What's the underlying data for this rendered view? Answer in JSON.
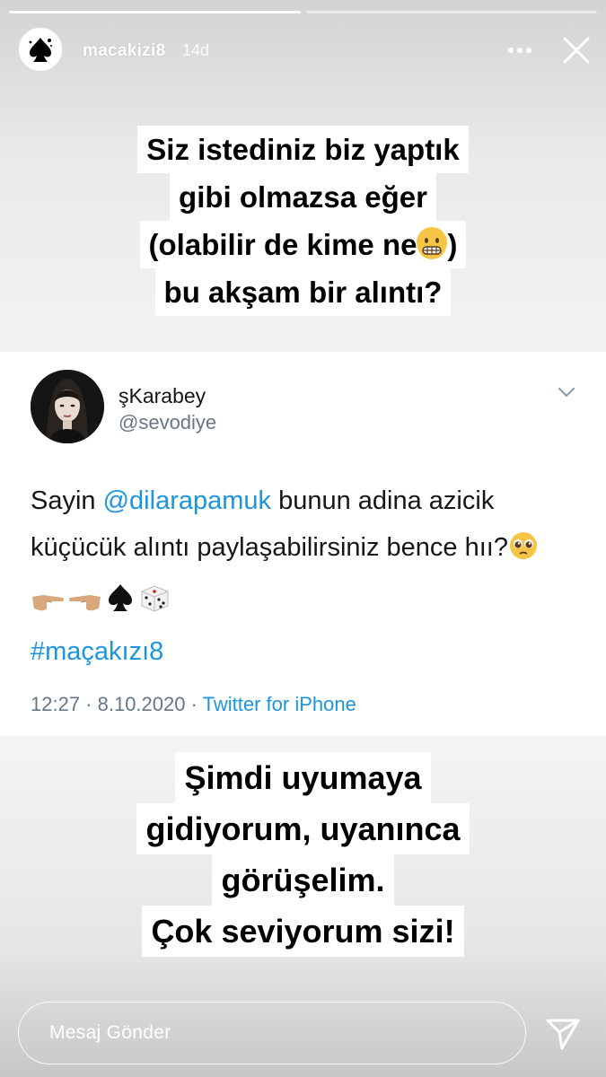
{
  "story": {
    "progress": [
      1.0,
      0.0
    ],
    "username": "macakizi8",
    "time_ago": "14d",
    "top_caption": [
      "Siz istediniz biz yaptık",
      "gibi olmazsa eğer",
      "(olabilir de kime ne",
      ")",
      "bu akşam bir alıntı?"
    ],
    "bottom_caption": [
      "Şimdi uyumaya",
      "gidiyorum, uyanınca",
      "görüşelim.",
      "Çok seviyorum sizi!"
    ],
    "message_placeholder": "Mesaj Gönder"
  },
  "tweet": {
    "name": "şKarabey",
    "handle": "@sevodiye",
    "body_pre": "Sayin ",
    "mention": "@dilarapamuk",
    "body_post": " bunun adina azicik küçücük alıntı paylaşabilirsiniz bence hıı?",
    "hashtag": "#maçakızı8",
    "timestamp": "12:27 · 8.10.2020 · ",
    "source": "Twitter for iPhone"
  },
  "icons": [
    "spade-logo-icon",
    "more-icon",
    "close-icon",
    "chevron-down-icon",
    "send-icon",
    "grimace-emoji-icon",
    "pleading-emoji-icon",
    "pointing-right-emoji-icon",
    "pointing-left-emoji-icon",
    "spade-suit-emoji-icon",
    "dice-emoji-icon"
  ],
  "colors": {
    "link": "#1b95e0",
    "muted": "#657786",
    "text": "#14171a"
  }
}
